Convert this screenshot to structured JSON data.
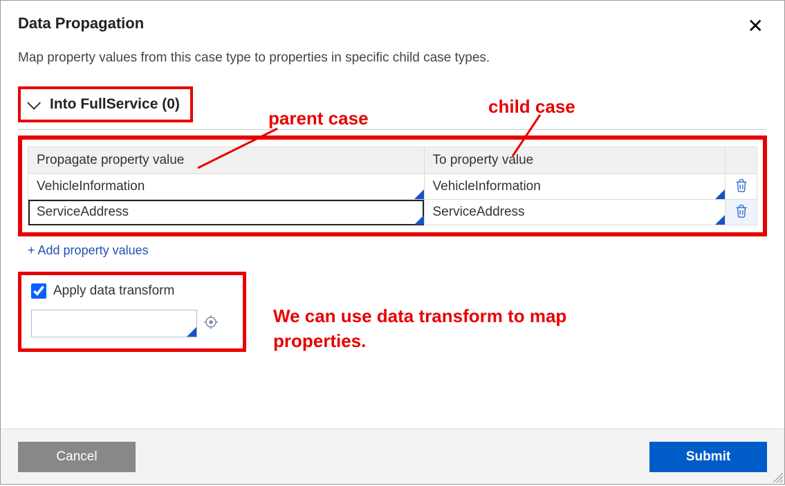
{
  "dialog": {
    "title": "Data Propagation",
    "description": "Map property values from this case type to properties in specific child case types.",
    "collapser_label": "Into FullService (0)"
  },
  "table": {
    "col1": "Propagate property value",
    "col2": "To property value",
    "rows": [
      {
        "from": "VehicleInformation",
        "to": "VehicleInformation"
      },
      {
        "from": "ServiceAddress",
        "to": "ServiceAddress"
      }
    ]
  },
  "add_link": "+ Add property values",
  "data_transform": {
    "label": "Apply data transform",
    "checked": true,
    "value": ""
  },
  "annotations": {
    "a1": "parent case",
    "a2": "child case",
    "a3": "We can use data transform to map properties."
  },
  "footer": {
    "cancel": "Cancel",
    "submit": "Submit"
  }
}
